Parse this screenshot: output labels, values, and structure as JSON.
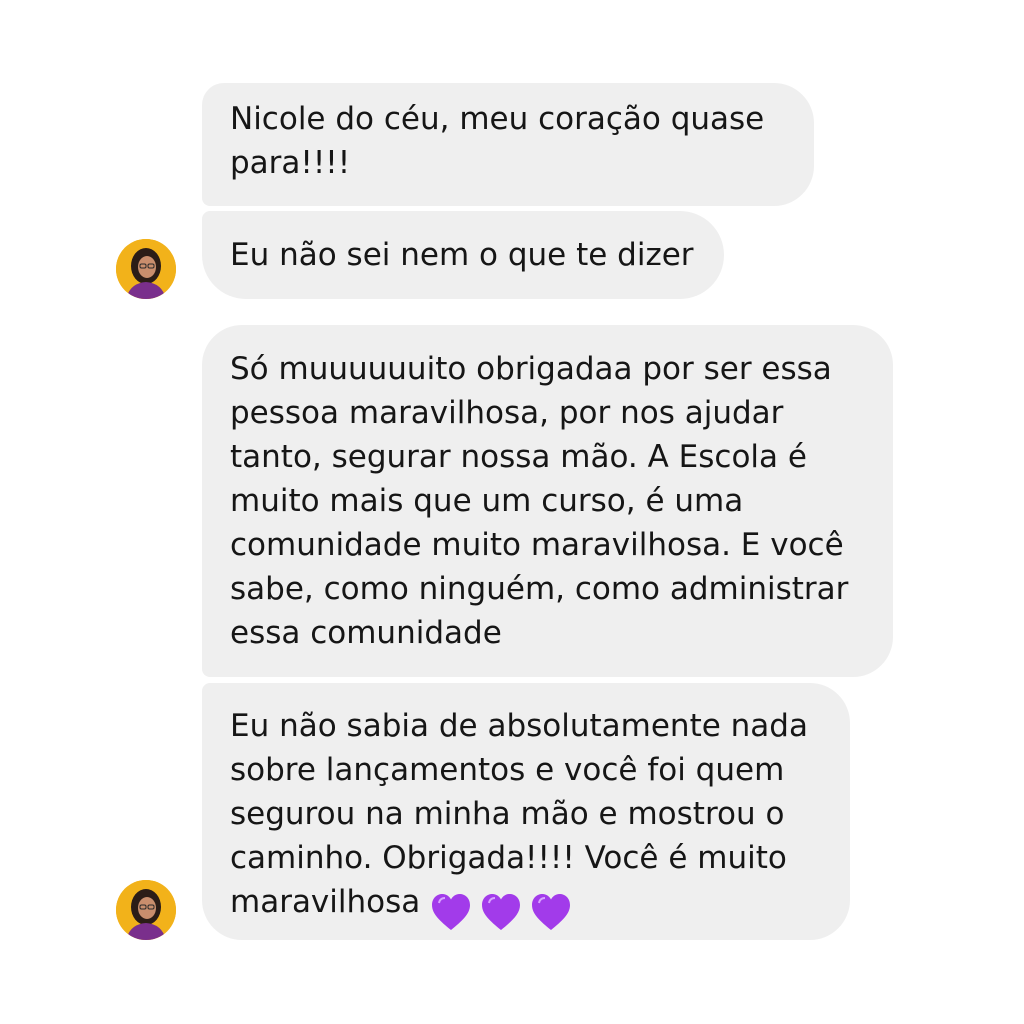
{
  "messages": [
    {
      "text": "Nicole do céu, meu coração quase\npara!!!!"
    },
    {
      "text": "Eu não sei nem o que te dizer"
    },
    {
      "text": "Só muuuuuuito obrigadaa por ser essa\npessoa maravilhosa, por nos ajudar\ntanto, segurar nossa mão. A Escola é\nmuito mais que um curso, é uma\ncomunidade muito maravilhosa. E você\nsabe, como ninguém, como administrar\nessa comunidade"
    },
    {
      "text": "Eu não sabia de absolutamente nada\nsobre lançamentos e você foi quem\nsegurou na minha mão e mostrou o\ncaminho. Obrigada!!!! Você é muito\nmaravilhosa",
      "emoji": [
        "purple-heart",
        "purple-heart",
        "purple-heart"
      ]
    }
  ],
  "colors": {
    "bubble": "#efefef",
    "text": "#161616",
    "avatar_bg": "#f2b21a",
    "heart": "#a23bea"
  }
}
